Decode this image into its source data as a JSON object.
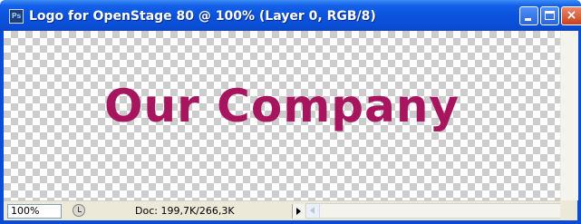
{
  "window": {
    "title": "Logo for OpenStage 80 @ 100% (Layer 0, RGB/8)",
    "app_icon_label": "Ps",
    "controls": {
      "minimize_icon": "minimize-icon",
      "maximize_icon": "maximize-icon",
      "close_icon": "close-icon",
      "close_glyph": "×"
    }
  },
  "canvas": {
    "text": "Our Company",
    "text_color": "#a8155f",
    "background": "transparent-checkerboard"
  },
  "statusbar": {
    "zoom": "100%",
    "doc_info": "Doc: 199,7K/266,3K",
    "info_icon": "status-info-icon",
    "menu_icon": "status-menu-arrow-icon"
  },
  "colors": {
    "titlebar": "#0a52dc",
    "statusbar": "#ece9d8",
    "checker": "#cccccc"
  }
}
